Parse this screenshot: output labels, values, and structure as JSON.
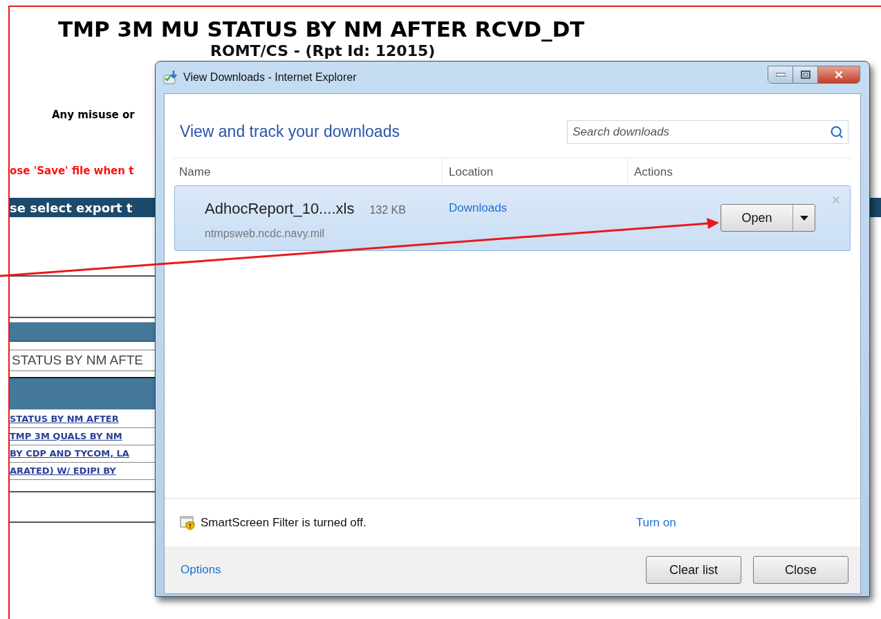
{
  "page": {
    "title": "TMP 3M MU STATUS BY NM AFTER RCVD_DT",
    "subtitle": "ROMT/CS - (Rpt Id: 12015)",
    "notice": "Any misuse or",
    "warning": "ose 'Save' file when t",
    "export_bar": "se select export t",
    "report_field": {
      "value": "STATUS BY NM AFTE"
    },
    "report_links": [
      "STATUS BY NM AFTER",
      "TMP 3M QUALS BY NM",
      "BY CDP AND TYCOM, LA",
      "ARATED) W/ EDIPI BY"
    ]
  },
  "dialog": {
    "title": "View Downloads - Internet Explorer",
    "heading": "View and track your downloads",
    "search": {
      "placeholder": "Search downloads"
    },
    "columns": [
      "Name",
      "Location",
      "Actions"
    ],
    "downloads": [
      {
        "name": "AdhocReport_10....xls",
        "size": "132 KB",
        "source": "ntmpsweb.ncdc.navy.mil",
        "location": "Downloads",
        "action": "Open",
        "selected": true
      }
    ],
    "smartscreen": {
      "message": "SmartScreen Filter is turned off.",
      "link": "Turn on"
    },
    "footer": {
      "link": "Options",
      "buttons": [
        "Clear list",
        "Close"
      ]
    }
  }
}
